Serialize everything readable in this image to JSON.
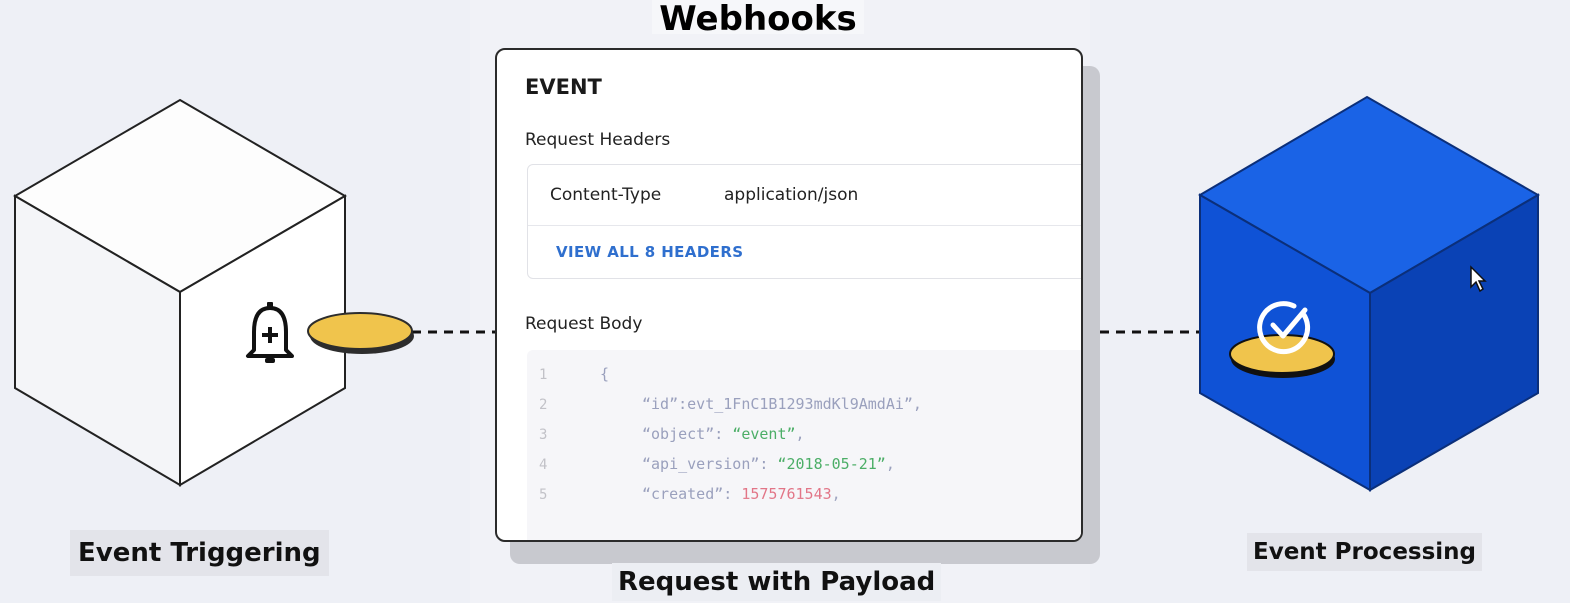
{
  "title": "Webhooks",
  "left_caption": "Event Triggering",
  "right_caption": "Event Processing",
  "middle_caption": "Request with Payload",
  "card": {
    "event_title": "EVENT",
    "headers_label": "Request Headers",
    "header_key": "Content-Type",
    "header_value": "application/json",
    "view_all_link": "VIEW ALL 8 HEADERS",
    "body_label": "Request Body",
    "code_lines": {
      "ln1": "1",
      "ln2": "2",
      "ln3": "3",
      "ln4": "4",
      "ln5": "5",
      "open_brace": "{",
      "id_key": "“id”:",
      "id_value": "evt_1FnC1B1293mdKl9AmdAi”,",
      "object_key": "“object”: ",
      "object_value": "“event”",
      "api_key": "“api_version”: ",
      "api_value": "“2018-05-21”",
      "created_key": "“created”: ",
      "created_value": "1575761543",
      "comma": ","
    }
  },
  "icons": {
    "left": "bell-plus-icon",
    "right": "check-circle-icon",
    "pointer": "mouse-cursor-icon"
  },
  "colors": {
    "blue_cube_top": "#1a63e6",
    "blue_cube_left": "#0f52d6",
    "blue_cube_right": "#0a42b5",
    "token": "#f0c44c",
    "link": "#2f6fce"
  }
}
